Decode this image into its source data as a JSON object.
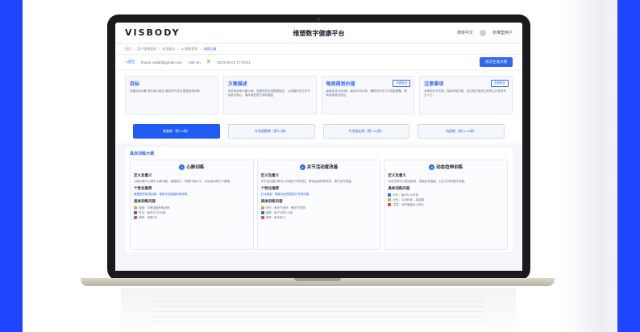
{
  "app": {
    "logo": "VISBODY",
    "title": "维塑数字健康平台",
    "language": "简体中文",
    "user": "张维塑用户"
  },
  "breadcrumb": [
    "首页",
    "用户健康管理",
    "检测报告",
    "AI 健康规划",
    "训练大纲"
  ],
  "user_bar": {
    "back": "返回",
    "email": "hauue.veddd@gmail.com",
    "height": "168 cm",
    "gender": "男",
    "date": "2023-06-02 17:03:51",
    "primary_button": "再次生成大纲"
  },
  "info_cards": [
    {
      "title": "目标",
      "text": "改善体态问题 提升核心稳定 增强关节灵活 塑造身体线条"
    },
    {
      "title": "方案描述",
      "text": "本阶段训练为期12周，根据您的检测数据制定，以改善体态与关节功能为核心，循序渐进提升训练强度。"
    },
    {
      "title": "每周规划价值",
      "text": "每周安排3次训练，每次约45分钟，兼顾动作学习与体能储备，帮助身体逐步适应。",
      "tag": "查看更多"
    },
    {
      "title": "注意事项",
      "text": "训练前充分热身，保持呼吸节奏，如出现不适请立即停止并咨询专业人士。",
      "tag": "查看更多"
    }
  ],
  "phases": [
    {
      "label": "准备期（第1-2周）",
      "active": true
    },
    {
      "label": "专项调整期（第3-6周）",
      "active": false
    },
    {
      "label": "专项强化期（第7-10周）",
      "active": false
    },
    {
      "label": "巩固期（第11-12周）",
      "active": false
    }
  ],
  "plan": {
    "title": "具体训练大纲",
    "cards": [
      {
        "num": "1",
        "title": "心肺训练",
        "def_head": "定义及意义",
        "def_text": "心肺训练可以提升心肺功能，增强耐力，改善代谢水平，为后续训练打下基础。",
        "tip_head": "个性化推荐",
        "tip_text": "根据您的检测结果，推荐中低强度有氧训练。",
        "content_head": "具体训练内容",
        "items": [
          "强度：中等强度有氧训练",
          "时长：每次20-30分钟",
          "频率：每周3次"
        ]
      },
      {
        "num": "2",
        "title": "关节活动度改善",
        "def_head": "定义及意义",
        "def_text": "关节活动度训练可以改善关节灵活性，降低运动损伤风险，提升动作质量。",
        "tip_head": "个性化推荐",
        "tip_text": "针对肩部、髋部活动受限进行专项改善。",
        "content_head": "具体训练内容",
        "items": [
          "动作：肩关节绕环、髋关节拉伸",
          "组数：每个动作2-3组",
          "频率：每天练习"
        ]
      },
      {
        "num": "3",
        "title": "动态拉伸训练",
        "def_head": "定义及意义",
        "def_text": "动态拉伸可以激活肌肉，提高身体温度，为正式训练做好准备。",
        "tip_head": "",
        "tip_text": "",
        "content_head": "具体训练内容",
        "items": [
          "时长：每次5-10分钟",
          "动作：弓步转体、高抬腿",
          "注意：动作幅度由小到大"
        ]
      }
    ]
  },
  "colors": {
    "accent": "#2f66f6",
    "stripe": "#1f45ff"
  }
}
